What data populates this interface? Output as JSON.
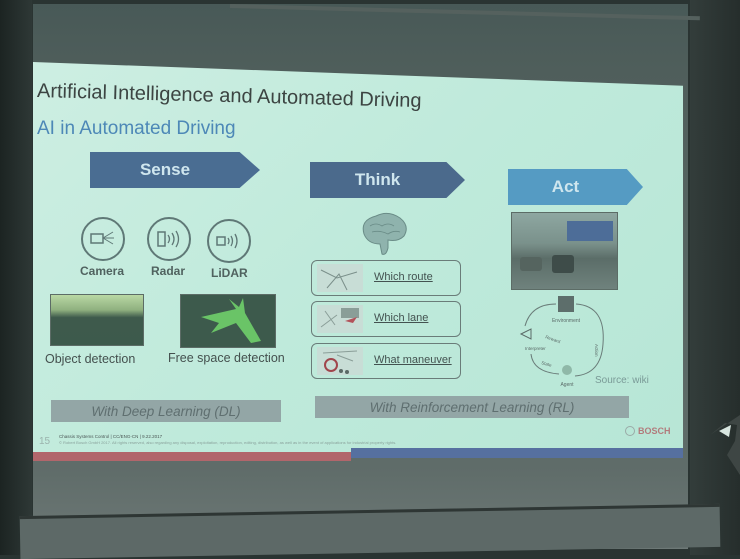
{
  "slide": {
    "title": "Artificial Intelligence and Automated Driving",
    "subtitle": "AI in Automated Driving",
    "columns": {
      "sense": {
        "label": "Sense",
        "sensors": [
          {
            "label": "Camera",
            "icon": "camera-icon"
          },
          {
            "label": "Radar",
            "icon": "radar-icon"
          },
          {
            "label": "LiDAR",
            "icon": "lidar-icon"
          }
        ],
        "detections": [
          {
            "label": "Object detection"
          },
          {
            "label": "Free space detection"
          }
        ],
        "method": "With Deep Learning (DL)"
      },
      "think": {
        "label": "Think",
        "items": [
          {
            "label": "Which route"
          },
          {
            "label": "Which lane"
          },
          {
            "label": "What maneuver"
          }
        ]
      },
      "act": {
        "label": "Act",
        "diagram_labels": {
          "environment": "Environment",
          "reward": "Reward",
          "interpreter": "Interpreter",
          "state": "State",
          "action": "Action",
          "agent": "Agent"
        },
        "source": "Source: wiki"
      }
    },
    "rl_method": "With Reinforcement Learning (RL)",
    "footer": {
      "page_number": "15",
      "line1": "Chassis Systems Control | CC/ENG-CN | 9.22.2017",
      "line2": "© Robert Bosch GmbH 2017. All rights reserved, also regarding any disposal, exploitation, reproduction, editing, distribution, as well as in the event of applications for industrial property rights."
    },
    "brand": "BOSCH",
    "colors": {
      "sense_arrow": "#4a6d92",
      "think_arrow": "#4b6a8c",
      "act_arrow": "#559bc3",
      "subtitle": "#4d88b7",
      "label_bar": "#93a6a6",
      "stripe_red": "#b1666b",
      "stripe_blue": "#5670a0"
    }
  }
}
